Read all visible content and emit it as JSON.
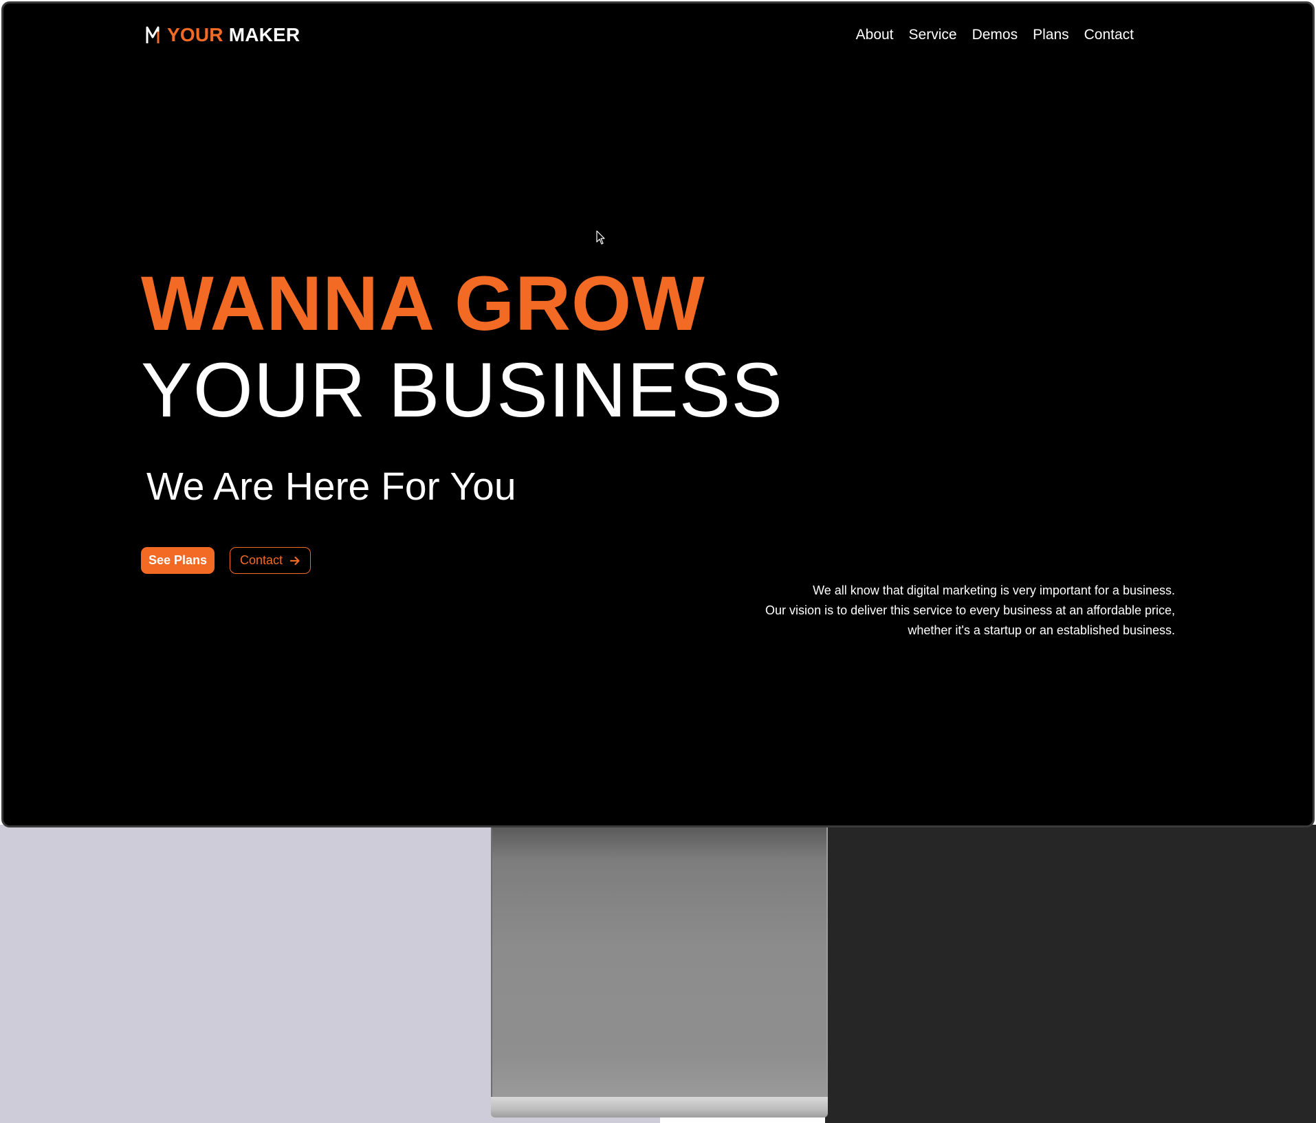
{
  "brand": {
    "part1": "YOUR",
    "part2": "MAKER",
    "accent": "#f26a24",
    "logo_icon": "m-logo-icon"
  },
  "nav": {
    "items": [
      "About",
      "Service",
      "Demos",
      "Plans",
      "Contact"
    ]
  },
  "hero": {
    "line1": "WANNA GROW",
    "line2": "YOUR BUSINESS",
    "subtitle": "We Are Here For You"
  },
  "buttons": {
    "plans": "See Plans",
    "contact": "Contact",
    "contact_icon": "arrow-right-icon"
  },
  "description": {
    "lines": [
      "We all know that digital marketing is very important for a business.",
      "Our vision is to deliver this service to every business at an affordable price,",
      "whether it's a startup or an established business."
    ]
  },
  "colors": {
    "background": "#000000",
    "accent": "#f26a24",
    "text": "#ffffff"
  }
}
